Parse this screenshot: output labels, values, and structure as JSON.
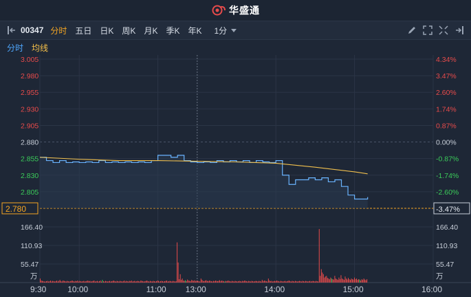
{
  "app": {
    "name": "华盛通"
  },
  "toolbar": {
    "code": "00347",
    "periods": [
      "分时",
      "五日",
      "日K",
      "周K",
      "月K",
      "季K",
      "年K"
    ],
    "active_period": "分时",
    "interval": "1分"
  },
  "legend": {
    "price_label": "分时",
    "avg_label": "均线"
  },
  "colors": {
    "price_line": "#6ab4ff",
    "avg_line": "#f2c14e",
    "up": "#e84b4b",
    "down": "#3bcc5a",
    "accent": "#f5a623",
    "bg": "#1e2736"
  },
  "current_price_tag": "2.780",
  "current_pct_tag": "-3.47%",
  "vol_unit": "万",
  "chart_data": [
    {
      "type": "line",
      "title": "",
      "x_ticks": [
        "9:30",
        "10:00",
        "11:00",
        "13:00",
        "14:00",
        "15:00",
        "16:00"
      ],
      "y_ticks_left": [
        "3.005",
        "2.980",
        "2.955",
        "2.930",
        "2.905",
        "2.880",
        "2.855",
        "2.830",
        "2.805",
        "2.780"
      ],
      "y_ticks_right": [
        "4.34%",
        "3.47%",
        "2.60%",
        "1.74%",
        "0.87%",
        "0.00%",
        "-0.87%",
        "-1.74%",
        "-2.60%",
        "-3.47%"
      ],
      "ylim": [
        2.78,
        3.005
      ],
      "prev_close": 2.88,
      "series": [
        {
          "name": "分时",
          "x": [
            "9:30",
            "9:35",
            "9:40",
            "9:45",
            "9:50",
            "9:55",
            "10:00",
            "10:05",
            "10:10",
            "10:15",
            "10:20",
            "10:25",
            "10:30",
            "10:35",
            "10:40",
            "10:45",
            "10:50",
            "10:55",
            "11:00",
            "11:05",
            "11:10",
            "11:15",
            "11:20",
            "11:25",
            "11:30",
            "13:00",
            "13:05",
            "13:10",
            "13:15",
            "13:20",
            "13:25",
            "13:30",
            "13:35",
            "13:40",
            "13:45",
            "13:50",
            "13:55",
            "14:00",
            "14:05",
            "14:10",
            "14:15",
            "14:20",
            "14:25",
            "14:30",
            "14:35",
            "14:40",
            "14:45",
            "14:50",
            "14:55",
            "15:00",
            "15:05",
            "15:10"
          ],
          "values": [
            2.857,
            2.852,
            2.849,
            2.852,
            2.849,
            2.85,
            2.849,
            2.85,
            2.849,
            2.852,
            2.849,
            2.85,
            2.849,
            2.85,
            2.849,
            2.85,
            2.849,
            2.852,
            2.86,
            2.86,
            2.857,
            2.86,
            2.852,
            2.85,
            2.85,
            2.849,
            2.85,
            2.849,
            2.852,
            2.85,
            2.852,
            2.85,
            2.852,
            2.849,
            2.852,
            2.85,
            2.849,
            2.852,
            2.83,
            2.816,
            2.823,
            2.823,
            2.826,
            2.823,
            2.826,
            2.82,
            2.823,
            2.813,
            2.8,
            2.794,
            2.794,
            2.797
          ]
        },
        {
          "name": "均线",
          "x": [
            "9:30",
            "10:00",
            "10:30",
            "11:00",
            "11:30",
            "13:00",
            "13:30",
            "14:00",
            "14:30",
            "15:00",
            "15:10"
          ],
          "values": [
            2.857,
            2.854,
            2.852,
            2.852,
            2.851,
            2.851,
            2.85,
            2.848,
            2.842,
            2.835,
            2.832
          ]
        }
      ]
    },
    {
      "type": "bar",
      "title": "",
      "ylabel": "万",
      "y_ticks": [
        "166.40",
        "110.93",
        "55.47"
      ],
      "ylim": [
        0,
        166.4
      ],
      "volumes": [
        12,
        6,
        5,
        4,
        3,
        3,
        4,
        5,
        3,
        4,
        6,
        3,
        5,
        4,
        3,
        4,
        6,
        3,
        5,
        8,
        4,
        3,
        6,
        5,
        4,
        3,
        5,
        4,
        3,
        4,
        5,
        6,
        4,
        3,
        5,
        4,
        6,
        3,
        5,
        4,
        3,
        4,
        5,
        3,
        4,
        5,
        6,
        4,
        5,
        3,
        4,
        5,
        6,
        3,
        4,
        5,
        3,
        4,
        6,
        3,
        8,
        4,
        3,
        5,
        4,
        3,
        4,
        5,
        3,
        4,
        5,
        6,
        4,
        3,
        5,
        4,
        3,
        5,
        4,
        3,
        4,
        6,
        3,
        5,
        4,
        3,
        5,
        4,
        6,
        3,
        4,
        5,
        3,
        4,
        5,
        4,
        3,
        6,
        5,
        4,
        3,
        4,
        5,
        6,
        4,
        3,
        5,
        4,
        3,
        5,
        4,
        3,
        4,
        6,
        5,
        3,
        4,
        5,
        4,
        3,
        4,
        5,
        6,
        3,
        4,
        5,
        4,
        3,
        5,
        4,
        3,
        4,
        120,
        60,
        10,
        25,
        8,
        12,
        6,
        5,
        7,
        4,
        9,
        6,
        5,
        4,
        8,
        6,
        5,
        7,
        4,
        6,
        5,
        4,
        3,
        12,
        8,
        5,
        4,
        6,
        7,
        5,
        4,
        6,
        5,
        4,
        3,
        5,
        4,
        6,
        5,
        4,
        5,
        7,
        4,
        6,
        5,
        4,
        3,
        5,
        4,
        6,
        5,
        4,
        3,
        5,
        4,
        3,
        5,
        4,
        3,
        4,
        5,
        4,
        3,
        5,
        4,
        6,
        5,
        4,
        3,
        5,
        4,
        3,
        5,
        4,
        3,
        4,
        5,
        4,
        3,
        5,
        4,
        3,
        8,
        4,
        6,
        5,
        4,
        3,
        12,
        6,
        4,
        5,
        3,
        4,
        5,
        4,
        6,
        5,
        4,
        3,
        5,
        4,
        3,
        4,
        5,
        3,
        4,
        5,
        6,
        4,
        3,
        5,
        4,
        3,
        5,
        4,
        3,
        4,
        5,
        4,
        3,
        5,
        4,
        3,
        5,
        4,
        3,
        4,
        5,
        3,
        4,
        5,
        4,
        3,
        5,
        4,
        3,
        160,
        20,
        40,
        30,
        25,
        15,
        18,
        20,
        14,
        12,
        10,
        15,
        12,
        10,
        9,
        20,
        12,
        10,
        8,
        15,
        10,
        22,
        12,
        10,
        8,
        18,
        12,
        9,
        14,
        10,
        8,
        12,
        10,
        9,
        15,
        10,
        12,
        8,
        10,
        9,
        6,
        10,
        8,
        12,
        9,
        7,
        10
      ],
      "down_indices": [
        60,
        140,
        178,
        281,
        308
      ]
    }
  ]
}
